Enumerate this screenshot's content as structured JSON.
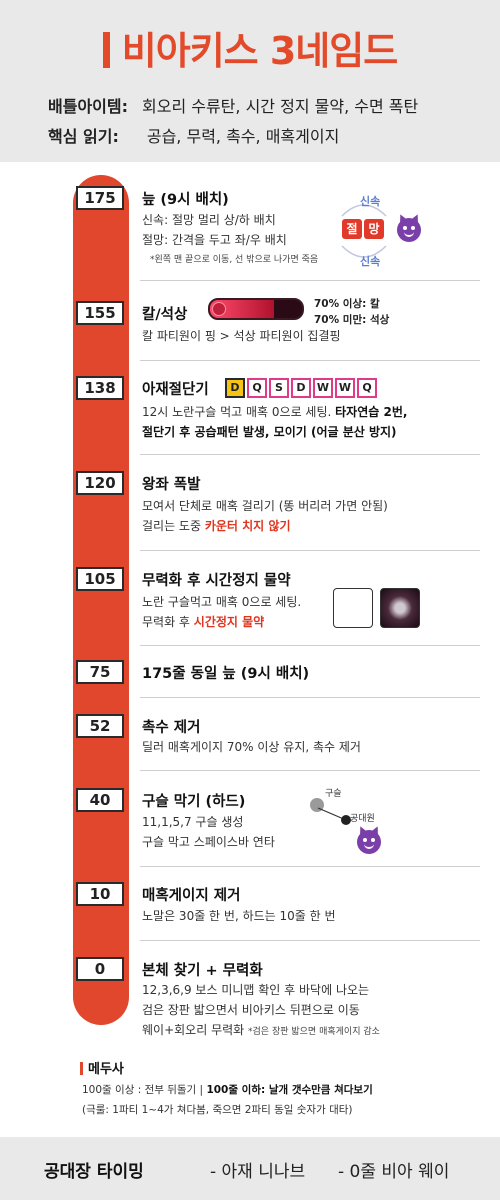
{
  "header": {
    "title": "비아키스 3네임드",
    "battle_items_label": "배틀아이템:",
    "battle_items": "회오리 수류탄, 시간 정지 물약, 수면 폭탄",
    "core_label": "핵심 읽기:",
    "core": "공습, 무력, 촉수, 매혹게이지"
  },
  "rows": [
    {
      "line": "175",
      "title": "늪 (9시 배치)",
      "text1": "신속: 절망 멀리 상/하 배치",
      "text2": "절망: 간격을 두고 좌/우 배치",
      "note": "*왼쪽 맨 끝으로 이동, 선 밖으로 나가면 죽음",
      "speed_top": "신속",
      "speed_bottom": "신속",
      "curse1": "절",
      "curse2": "망"
    },
    {
      "line": "155",
      "title": "칼/석상",
      "gauge_high": "70% 이상: 칼",
      "gauge_low": "70% 미만: 석상",
      "text1": "칼 파티원이 핑 > 석상 파티원이 집결핑"
    },
    {
      "line": "138",
      "title": "아재절단기",
      "keys": [
        "D",
        "Q",
        "S",
        "D",
        "W",
        "W",
        "Q"
      ],
      "text1_pre": "12시 노란구슬 먹고 매혹 0으로 세팅. ",
      "text1_bold": "타자연습 2번,",
      "text2": "절단기 후 공습패턴 발생, 모이기 (어글 분산 방지)"
    },
    {
      "line": "120",
      "title": "왕좌 폭발",
      "text1": "모여서 단체로 매혹 걸리기 (똥 버리러 가면 안됨)",
      "text2_pre": "걸리는 도중 ",
      "text2_red": "카운터 치지 않기"
    },
    {
      "line": "105",
      "title": "무력화 후 시간정지 물약",
      "text1": "노란 구슬먹고 매혹 0으로 세팅.",
      "text2_pre": "무력화 후 ",
      "text2_red": "시간정지 물약"
    },
    {
      "line": "75",
      "title": "175줄 동일 늪 (9시 배치)"
    },
    {
      "line": "52",
      "title": "촉수 제거",
      "text1": "딜러 매혹게이지 70% 이상 유지, 촉수 제거"
    },
    {
      "line": "40",
      "title": "구슬 막기 (하드)",
      "text1": "11,1,5,7 구슬 생성",
      "text2": "구슬 막고 스페이스바 연타",
      "diag_orb": "구슬",
      "diag_member": "공대원"
    },
    {
      "line": "10",
      "title": "매혹게이지 제거",
      "text1": "노말은 30줄 한 번, 하드는 10줄 한 번"
    },
    {
      "line": "0",
      "title": "본체 찾기 + 무력화",
      "text1": "12,3,6,9 보스 미니맵 확인 후 바닥에 나오는",
      "text2": "검은 장판 밟으면서 비아키스 뒤편으로 이동",
      "text3": "웨이+회오리 무력화",
      "note": "*검은 장판 밟으면 매혹게이지 감소"
    }
  ],
  "medusa": {
    "title": "메두사",
    "line1_pre": "100줄 이상 : 전부 뒤돌기    |    ",
    "line1_bold": "100줄 이하: 날개 갯수만큼 쳐다보기",
    "line2": "(극룰: 1파티 1~4가 쳐다봄, 죽으면 2파티 동일 숫자가 대타)"
  },
  "footer": {
    "label": "공대장 타이밍",
    "item1": "- 아재 니나브",
    "item2": "- 0줄 비아 웨이"
  },
  "colors": {
    "accent": "#e0472d",
    "title": "#e24a2a",
    "speed": "#5a7fcf",
    "key_border": "#e23a8a",
    "key_first": "#f5c418"
  },
  "gauge_fill_fraction": 0.7
}
